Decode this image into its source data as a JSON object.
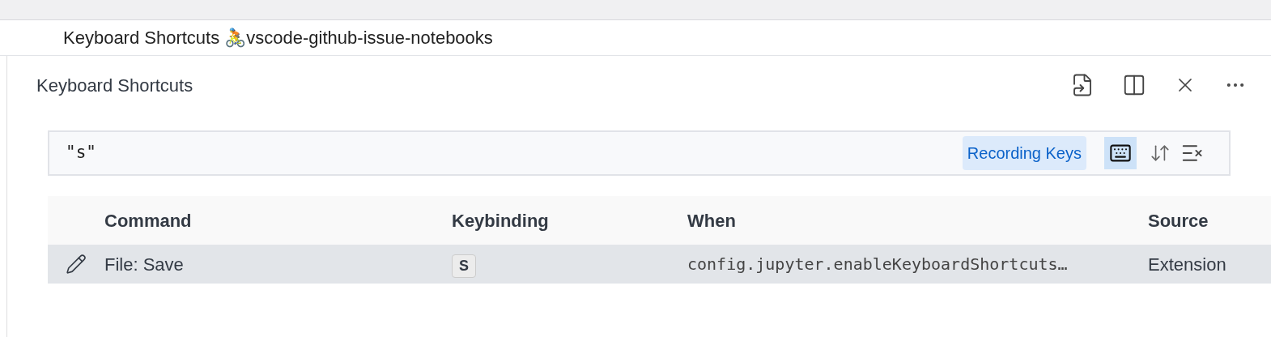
{
  "tab": {
    "title": "Keyboard Shortcuts 🚴vscode-github-issue-notebooks"
  },
  "editor": {
    "title": "Keyboard Shortcuts"
  },
  "search": {
    "value": "\"s\"",
    "badge": "Recording Keys",
    "record_keys_on": true
  },
  "table": {
    "columns": [
      "Command",
      "Keybinding",
      "When",
      "Source"
    ],
    "rows": [
      {
        "command": "File: Save",
        "keybinding": "S",
        "when": "config.jupyter.enableKeyboardShortcuts…",
        "source": "Extension",
        "selected": true
      }
    ]
  }
}
